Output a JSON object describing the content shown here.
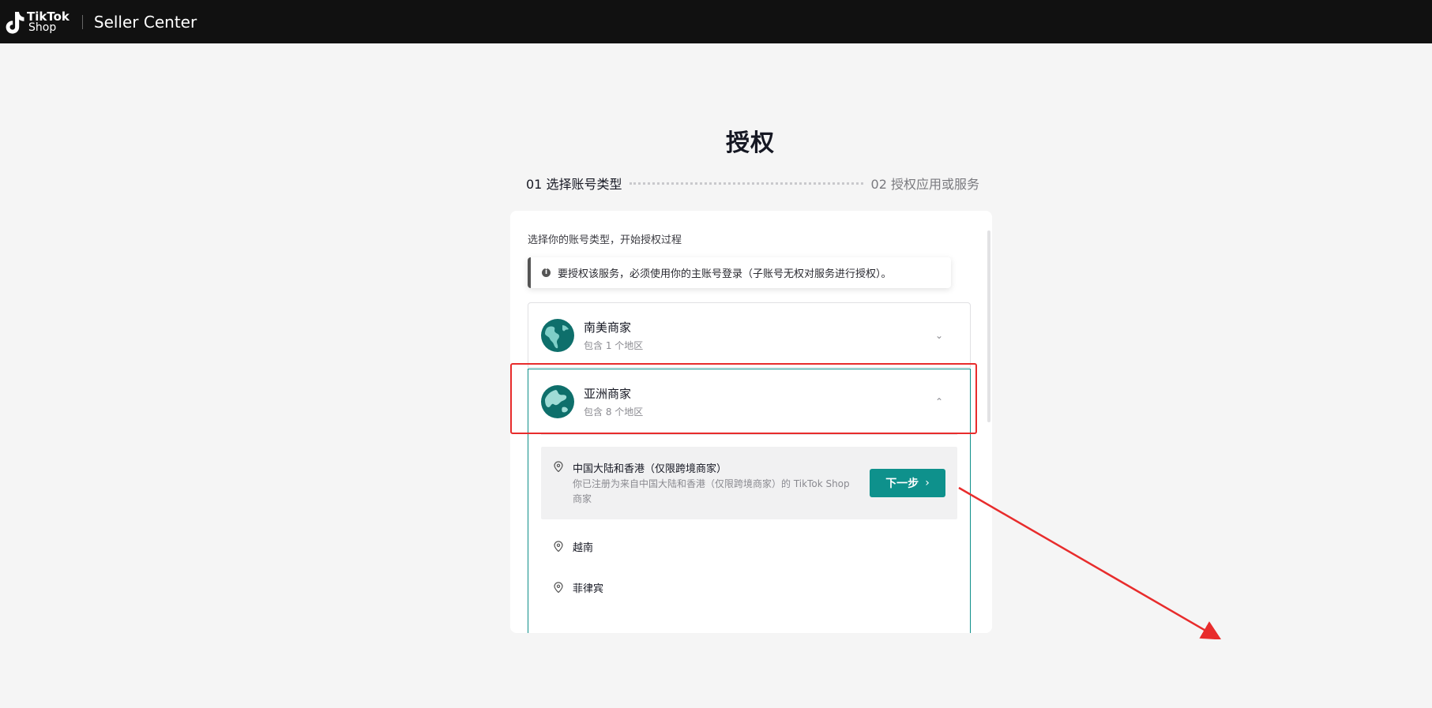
{
  "header": {
    "logo_line1": "TikTok",
    "logo_line2": "Shop",
    "app_title": "Seller Center"
  },
  "page": {
    "title": "授权",
    "steps": [
      {
        "label": "01 选择账号类型"
      },
      {
        "label": "02 授权应用或服务"
      }
    ]
  },
  "card": {
    "intro": "选择你的账号类型，开始授权过程",
    "notice": "要授权该服务，必须使用你的主账号登录（子账号无权对服务进行授权）。",
    "regions": [
      {
        "name": "南美商家",
        "sub": "包含 1 个地区",
        "expanded": false
      },
      {
        "name": "亚洲商家",
        "sub": "包含 8 个地区",
        "expanded": true
      }
    ],
    "asia_items": [
      {
        "title": "中国大陆和香港（仅限跨境商家）",
        "desc": "你已注册为来自中国大陆和香港（仅限跨境商家）的 TikTok Shop 商家",
        "button": "下一步"
      },
      {
        "title": "越南"
      },
      {
        "title": "菲律宾"
      }
    ]
  },
  "colors": {
    "accent": "#0e918c",
    "annotation": "#e82c2c",
    "header_bg": "#111111"
  }
}
